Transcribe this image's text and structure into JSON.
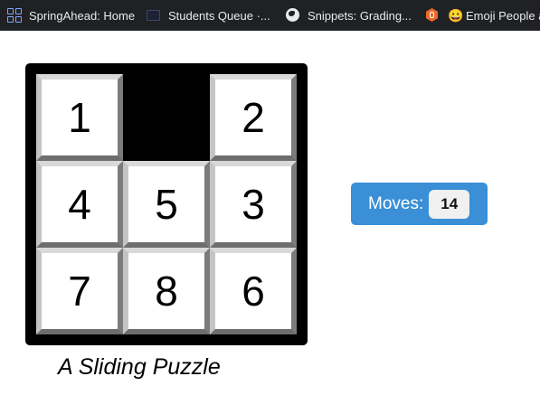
{
  "bookmarks": [
    {
      "icon": "grid-icon",
      "label": "SpringAhead: Home"
    },
    {
      "icon": "screen-icon",
      "label": "Students Queue ·..."
    },
    {
      "icon": "globe-icon",
      "label": "Snippets: Grading..."
    },
    {
      "icon": "hexagon-icon",
      "label": ""
    },
    {
      "icon": "smiley-emoji-icon",
      "label": "Emoji People a"
    }
  ],
  "puzzle": {
    "tiles": [
      "1",
      "",
      "2",
      "4",
      "5",
      "3",
      "7",
      "8",
      "6"
    ],
    "caption": "A Sliding Puzzle"
  },
  "moves": {
    "label": "Moves:",
    "count": "14"
  },
  "colors": {
    "bookmark_bar": "#202124",
    "frame": "#000000",
    "moves_bg": "#3a8fd6"
  }
}
